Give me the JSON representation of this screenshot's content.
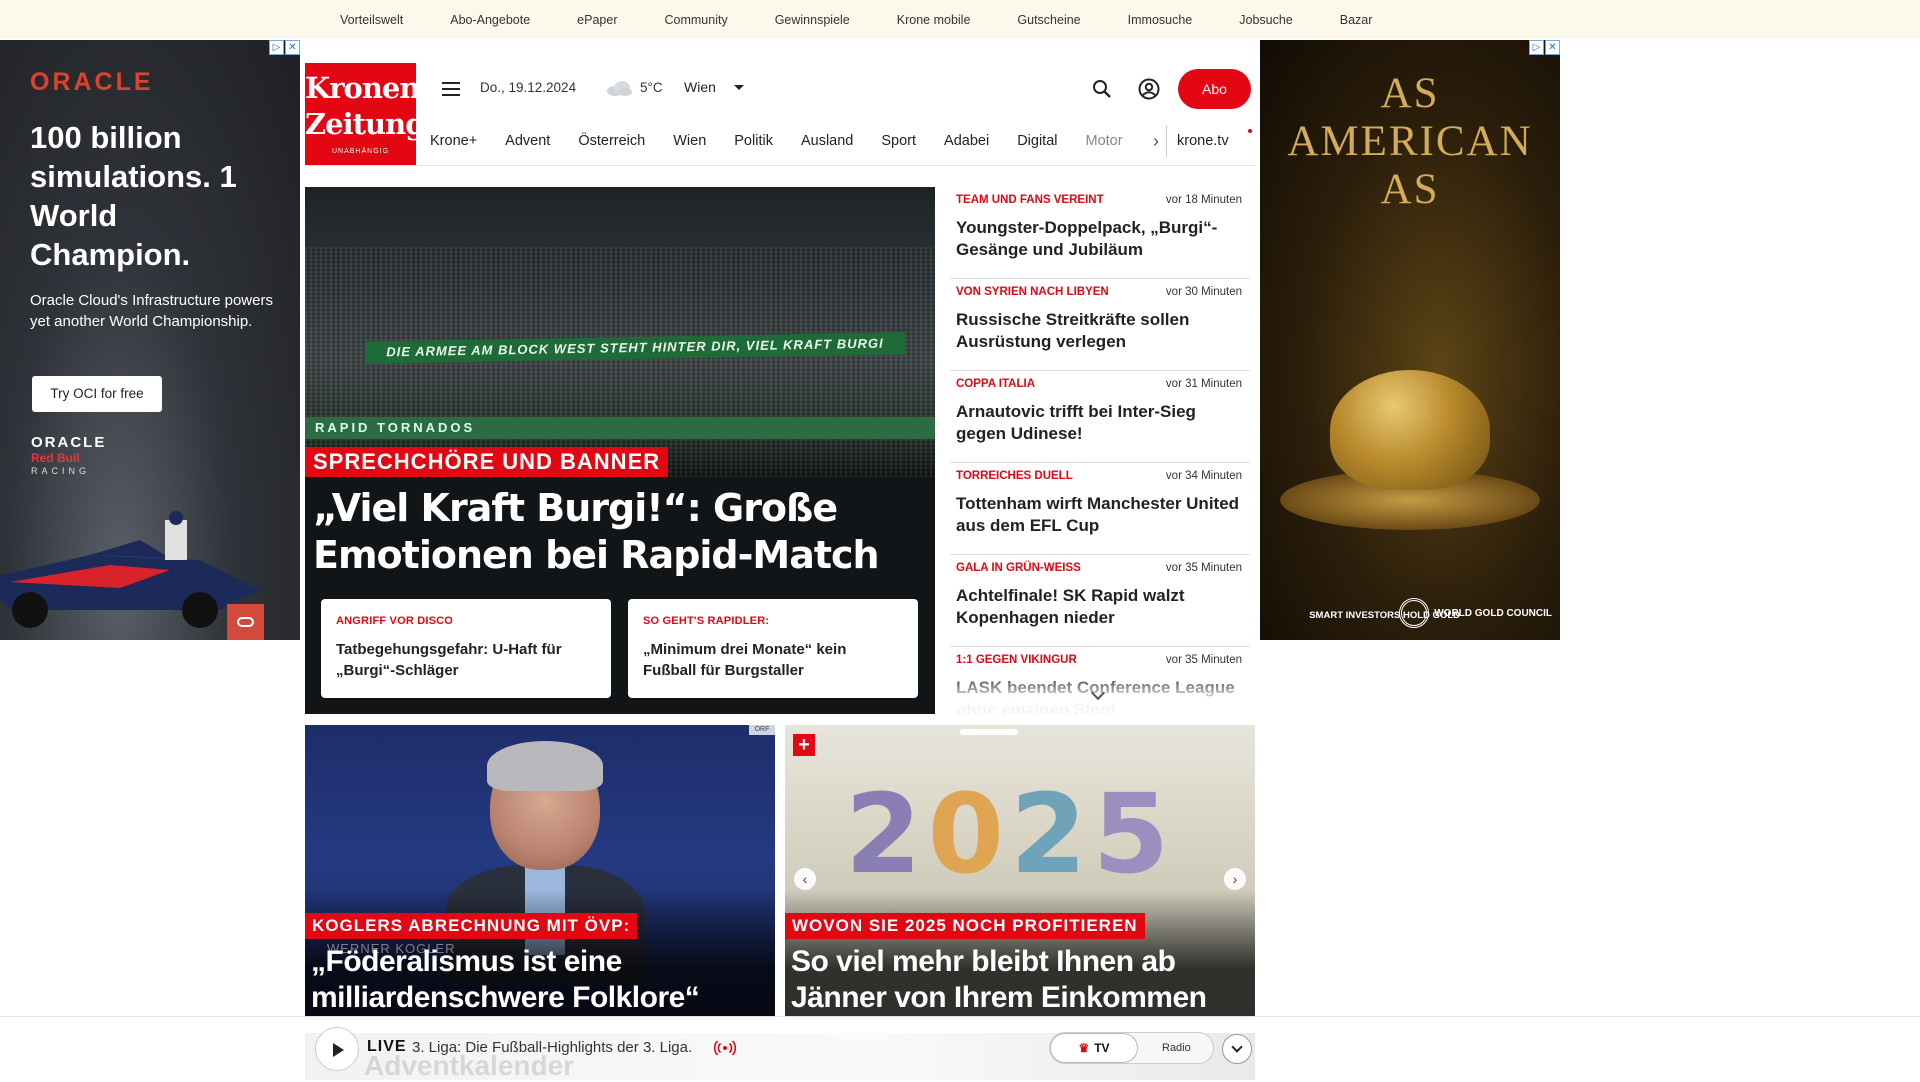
{
  "topbar": {
    "links": [
      "Vorteilswelt",
      "Abo-Angebote",
      "ePaper",
      "Community",
      "Gewinnspiele",
      "Krone mobile",
      "Gutscheine",
      "Immosuche",
      "Jobsuche",
      "Bazar"
    ]
  },
  "ad_left": {
    "brand": "ORACLE",
    "headline": "100 billion simulations. 1 World Champion.",
    "subline": "Oracle Cloud's Infrastructure powers yet another World Championship.",
    "cta": "Try OCI for free",
    "partner_brand": "ORACLE",
    "partner_name": "Red Bull",
    "partner_sub": "RACING"
  },
  "ad_right": {
    "headline": "AS AMERICAN AS",
    "footer": "SMART INVESTORS HOLD GOLD",
    "logo_text": "WORLD GOLD COUNCIL"
  },
  "header": {
    "logo_line1": "Kronen",
    "logo_line2": "Zeitung",
    "logo_tagline": "UNABHÄNGIG",
    "date": "Do., 19.12.2024",
    "temperature": "5°C",
    "city": "Wien",
    "abo_label": "Abo",
    "accent_color": "#e30613"
  },
  "nav": {
    "items": [
      "Krone+",
      "Advent",
      "Österreich",
      "Wien",
      "Politik",
      "Ausland",
      "Sport",
      "Adabei",
      "Digital"
    ],
    "cut_item": "Motor",
    "tv_label": "krone.tv"
  },
  "hero": {
    "banner_text": "DIE ARMEE AM BLOCK WEST STEHT HINTER DIR, VIEL KRAFT BURGI",
    "stadium_text": "RAPID TORNADOS",
    "kicker": "SPRECHCHÖRE UND BANNER",
    "title": "„Viel Kraft Burgi!“: Große Emotionen bei Rapid-Match",
    "subcards": [
      {
        "kicker": "ANGRIFF VOR DISCO",
        "title": "Tatbegehungsgefahr: U-Haft für „Burgi“-Schläger"
      },
      {
        "kicker": "SO GEHT'S RAPIDLER:",
        "title": "„Minimum drei Monate“ kein Fußball für Burgstaller"
      }
    ]
  },
  "ticker": {
    "items": [
      {
        "kicker": "TEAM UND FANS VEREINT",
        "time": "vor 18 Minuten",
        "title": "Youngster-Doppelpack, „Burgi“-Gesänge und Jubiläum"
      },
      {
        "kicker": "VON SYRIEN NACH LIBYEN",
        "time": "vor 30 Minuten",
        "title": "Russische Streitkräfte sollen Ausrüstung verlegen"
      },
      {
        "kicker": "COPPA ITALIA",
        "time": "vor 31 Minuten",
        "title": "Arnautovic trifft bei Inter-Sieg gegen Udinese!"
      },
      {
        "kicker": "TORREICHES DUELL",
        "time": "vor 34 Minuten",
        "title": "Tottenham wirft Manchester United aus dem EFL Cup"
      },
      {
        "kicker": "GALA IN GRÜN-WEISS",
        "time": "vor 35 Minuten",
        "title": "Achtelfinale! SK Rapid walzt Kopenhagen nieder"
      },
      {
        "kicker": "1:1 GEGEN VIKINGUR",
        "time": "vor 35 Minuten",
        "title": "LASK beendet Conference League ohne einzigen Sieg!"
      }
    ]
  },
  "cards": [
    {
      "kicker": "KOGLERS ABRECHNUNG MIT ÖVP:",
      "title": "„Föderalismus ist eine milliardenschwere Folklore“",
      "name_tag": "WERNER KOGLER",
      "source": "ORF"
    },
    {
      "kicker": "WOVON SIE 2025 NOCH PROFITIEREN",
      "title": "So viel mehr bleibt Ihnen ab Jänner von Ihrem Einkommen",
      "year_digits": [
        "2",
        "0",
        "2",
        "5"
      ],
      "plus_badge": "+"
    }
  ],
  "player": {
    "live_label": "LIVE",
    "now_playing": "3. Liga: Die Fußball-Highlights der 3. Liga.",
    "tv_label": "TV",
    "radio_label": "Radio",
    "behind_text": "Adventkalender"
  }
}
